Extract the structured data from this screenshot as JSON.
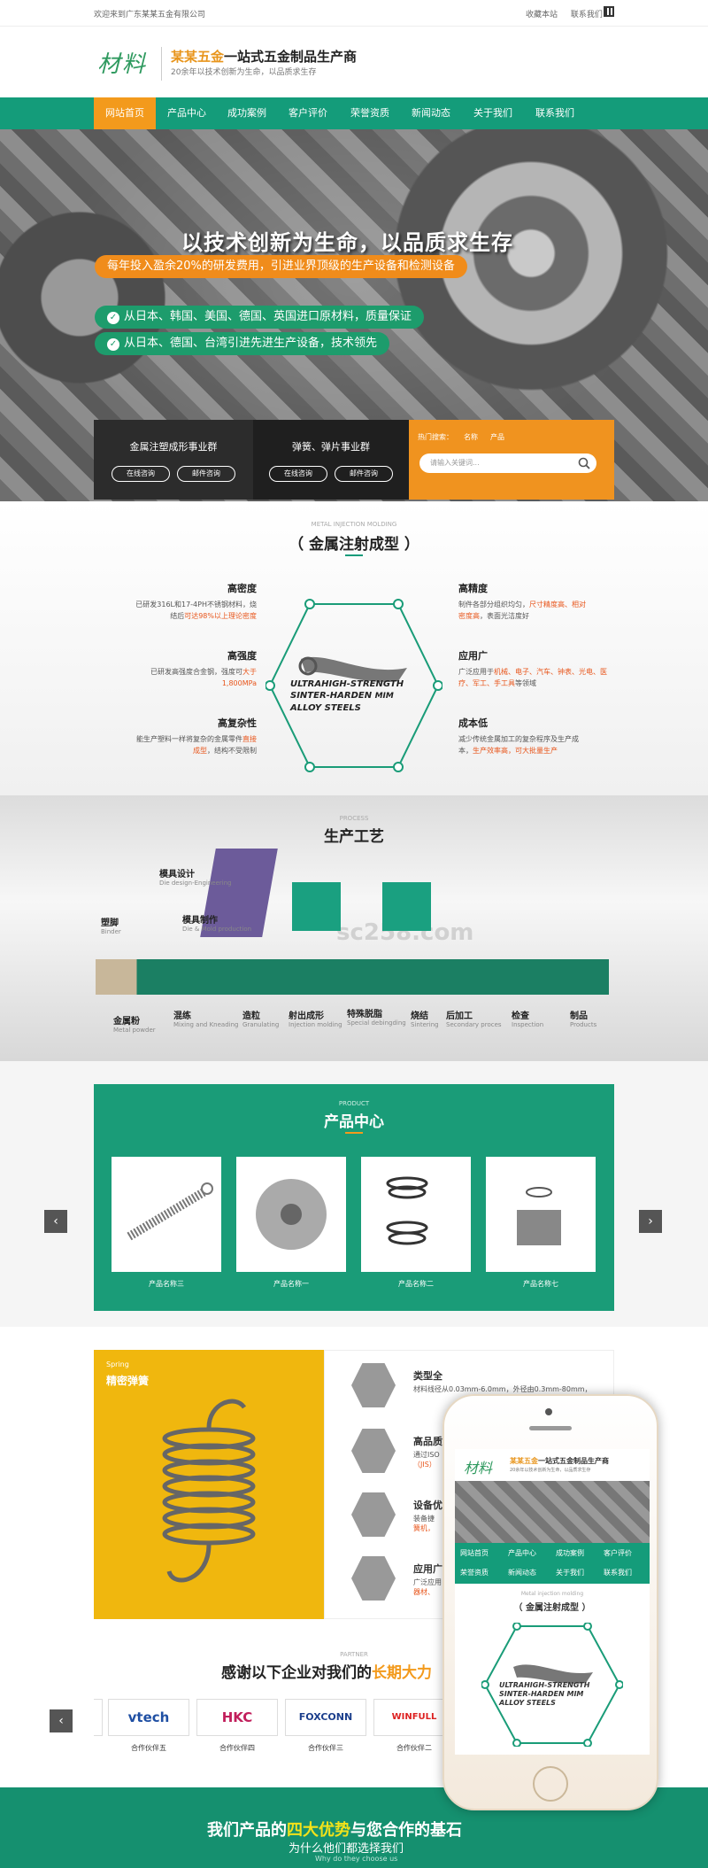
{
  "topbar": {
    "welcome": "欢迎来到广东某某五金有限公司",
    "favorite": "收藏本站",
    "contact": "联系我们"
  },
  "header": {
    "logo": "材料",
    "brand_highlight": "某某五金",
    "brand_rest": "一站式五金制品生产商",
    "tagline": "20余年以技术创新为生命，以品质求生存"
  },
  "nav": [
    "网站首页",
    "产品中心",
    "成功案例",
    "客户评价",
    "荣誉资质",
    "新闻动态",
    "关于我们",
    "联系我们"
  ],
  "hero": {
    "title": "以技术创新为生命，以品质求生存",
    "pill1": "每年投入盈余20%的研发费用，引进业界顶级的生产设备和检测设备",
    "pill2": "从日本、韩国、美国、德国、英国进口原材料，质量保证",
    "pill3": "从日本、德国、台湾引进先进生产设备，技术领先"
  },
  "boxes": {
    "b1_title": "金属注塑成形事业群",
    "b2_title": "弹簧、弹片事业群",
    "consult": "在线咨询",
    "mail": "邮件咨询",
    "search_label": "热门搜索：",
    "search_tab1": "名称",
    "search_tab2": "产品",
    "search_placeholder": "请输入关键词..."
  },
  "mim": {
    "en": "METAL INJECTION MOLDING",
    "title": "（ 金属注射成型 ）",
    "f1_h": "高密度",
    "f1_a": "已研发316L和17-4PH不锈钢材料，烧",
    "f1_b": "结后",
    "f1_o": "可达98%以上理论密度",
    "f2_h": "高强度",
    "f2_a": "已研发高强度合金钢，强度可",
    "f2_o1": "大于",
    "f2_o2": "1,800MPa",
    "f3_h": "高复杂性",
    "f3_a": "能生产塑料一样将复杂的金属零件",
    "f3_o1": "直接",
    "f3_o2": "成型",
    "f3_b": "，结构不受限制",
    "f4_h": "高精度",
    "f4_a": "制件各部分组织均匀，",
    "f4_o1": "尺寸精度高、相对",
    "f4_o2": "密度高",
    "f4_b": "，表面光洁度好",
    "f5_h": "应用广",
    "f5_a": "广泛应用于",
    "f5_o": "机械、电子、汽车、钟表、光电、医疗、军工、手工具",
    "f5_b": "等领域",
    "f6_h": "成本低",
    "f6_a": "减少传统金属加工的复杂程序及生产成",
    "f6_b": "本，",
    "f6_o": "生产效率高，可大批量生产",
    "center_line1": "ULTRAHIGH-STRENGTH",
    "center_line2": "SINTER-HARDEN",
    "center_line3": "ALLOY STEELS",
    "center_mim": "MIM"
  },
  "process": {
    "en": "PROCESS",
    "title": "生产工艺",
    "steps": [
      {
        "cn": "模具设计",
        "en": "Die design-Engineering"
      },
      {
        "cn": "模具制作",
        "en": "Die & Mold production"
      },
      {
        "cn": "塑脚",
        "en": "Binder"
      },
      {
        "cn": "金属粉",
        "en": "Metal powder"
      },
      {
        "cn": "混练",
        "en": "Mixing and Kneading"
      },
      {
        "cn": "造粒",
        "en": "Granulating"
      },
      {
        "cn": "射出成形",
        "en": "Injection molding"
      },
      {
        "cn": "特殊脱脂",
        "en": "Special debingding"
      },
      {
        "cn": "烧结",
        "en": "Sintering"
      },
      {
        "cn": "后加工",
        "en": "Secondary proces"
      },
      {
        "cn": "检查",
        "en": "Inspection"
      },
      {
        "cn": "制品",
        "en": "Products"
      }
    ],
    "watermark": "sc258.com"
  },
  "products": {
    "en": "PRODUCT",
    "title": "产品中心",
    "items": [
      "产品名称三",
      "产品名称一",
      "产品名称二",
      "产品名称七"
    ],
    "prev": "‹",
    "next": "›"
  },
  "spring": {
    "en": "Spring",
    "title": "精密弹簧",
    "f1_h": "类型全",
    "f1_t": "材料线径从0.03mm-6.0mm，外径由0.3mm-80mm，",
    "f2_h": "高品质",
    "f2_t": "通过ISO",
    "f2_t2": "（JIS）",
    "f3_h": "设备优",
    "f3_t": "装备捷",
    "f3_t2": "簧机，",
    "f4_h": "应用广",
    "f4_t": "广泛应用",
    "f4_t2": "器材、"
  },
  "partner": {
    "en": "PARTNER",
    "title_a": "感谢以下企业对我们的",
    "title_hl": "长期大力",
    "logos": [
      "vtech",
      "HKC",
      "FOXCONN",
      "WINFULL"
    ],
    "caps": [
      "合作伙伴五",
      "合作伙伴四",
      "合作伙伴三",
      "合作伙伴二"
    ],
    "prev": "‹"
  },
  "bottom": {
    "title_a": "我们产品的",
    "title_hl": "四大优势",
    "title_b": "与您合作的基石",
    "sub": "为什么他们都选择我们",
    "en": "Why do they choose us"
  },
  "phone": {
    "logo": "材料",
    "brand_hl": "某某五金",
    "brand_rest": "一站式五金制品生产商",
    "tagline": "20余年以技术创新为生命，以品质求生存",
    "nav": [
      "网站首页",
      "产品中心",
      "成功案例",
      "客户评价",
      "荣誉资质",
      "新闻动态",
      "关于我们",
      "联系我们"
    ],
    "en": "Metal injection molding",
    "title": "（ 金属注射成型 ）",
    "c1": "ULTRAHIGH-STRENGTH",
    "c2": "SINTER-HARDEN",
    "c3": "ALLOY STEELS",
    "c4": "MIM"
  },
  "colors": {
    "green": "#149c7a",
    "orange": "#f39a1c",
    "yellow": "#f0b70e"
  }
}
